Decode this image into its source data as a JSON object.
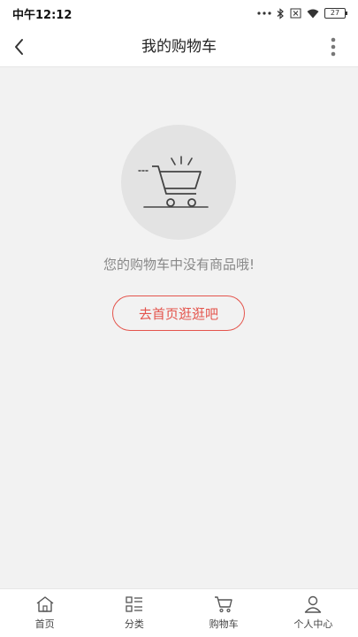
{
  "status_bar": {
    "time": "中午12:12",
    "battery": "27",
    "icons": [
      "more-dots-icon",
      "bluetooth-icon",
      "no-sim-icon",
      "wifi-icon",
      "battery-icon"
    ]
  },
  "header": {
    "title": "我的购物车",
    "back_icon": "chevron-left-icon",
    "more_icon": "more-vertical-icon"
  },
  "empty_state": {
    "illustration": "empty-cart-icon",
    "message": "您的购物车中没有商品哦!",
    "button_label": "去首页逛逛吧"
  },
  "tab_bar": {
    "items": [
      {
        "label": "首页",
        "icon": "home-icon"
      },
      {
        "label": "分类",
        "icon": "category-icon"
      },
      {
        "label": "购物车",
        "icon": "cart-icon"
      },
      {
        "label": "个人中心",
        "icon": "user-icon"
      }
    ]
  },
  "colors": {
    "accent": "#e4544c",
    "background": "#f2f2f2",
    "illustration_bg": "#e3e3e3"
  }
}
